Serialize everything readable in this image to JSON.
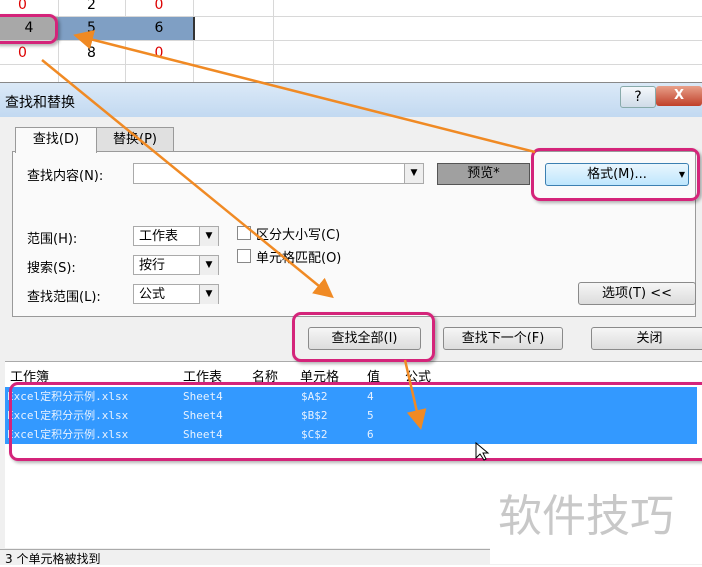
{
  "sheet": {
    "row1": [
      "0",
      "2",
      "0"
    ],
    "row2": [
      "4",
      "5",
      "6"
    ],
    "row3": [
      "0",
      "8",
      "0"
    ]
  },
  "dialog": {
    "title": "查找和替换",
    "help": "?",
    "close": "X",
    "tabs": [
      "查找(D)",
      "替换(P)"
    ],
    "find_label": "查找内容(N):",
    "find_value": "",
    "preview": "预览*",
    "format_button": "格式(M)...",
    "scope_label": "范围(H):",
    "scope_value": "工作表",
    "search_label": "搜索(S):",
    "search_value": "按行",
    "lookin_label": "查找范围(L):",
    "lookin_value": "公式",
    "match_case": "区分大小写(C)",
    "match_cell": "单元格匹配(O)",
    "options_button": "选项(T) <<",
    "find_all": "查找全部(I)",
    "find_next": "查找下一个(F)",
    "close_button": "关闭"
  },
  "results": {
    "headers": [
      "工作簿",
      "工作表",
      "名称",
      "单元格",
      "值",
      "公式"
    ],
    "rows": [
      [
        "Excel定积分示例.xlsx",
        "Sheet4",
        "",
        "$A$2",
        "4",
        ""
      ],
      [
        "Excel定积分示例.xlsx",
        "Sheet4",
        "",
        "$B$2",
        "5",
        ""
      ],
      [
        "Excel定积分示例.xlsx",
        "Sheet4",
        "",
        "$C$2",
        "6",
        ""
      ]
    ],
    "status": "3 个单元格被找到"
  },
  "watermark": "软件技巧",
  "colors": {
    "highlight": "#d4247a",
    "arrow": "#f08a24",
    "selection": "#3399ff"
  }
}
